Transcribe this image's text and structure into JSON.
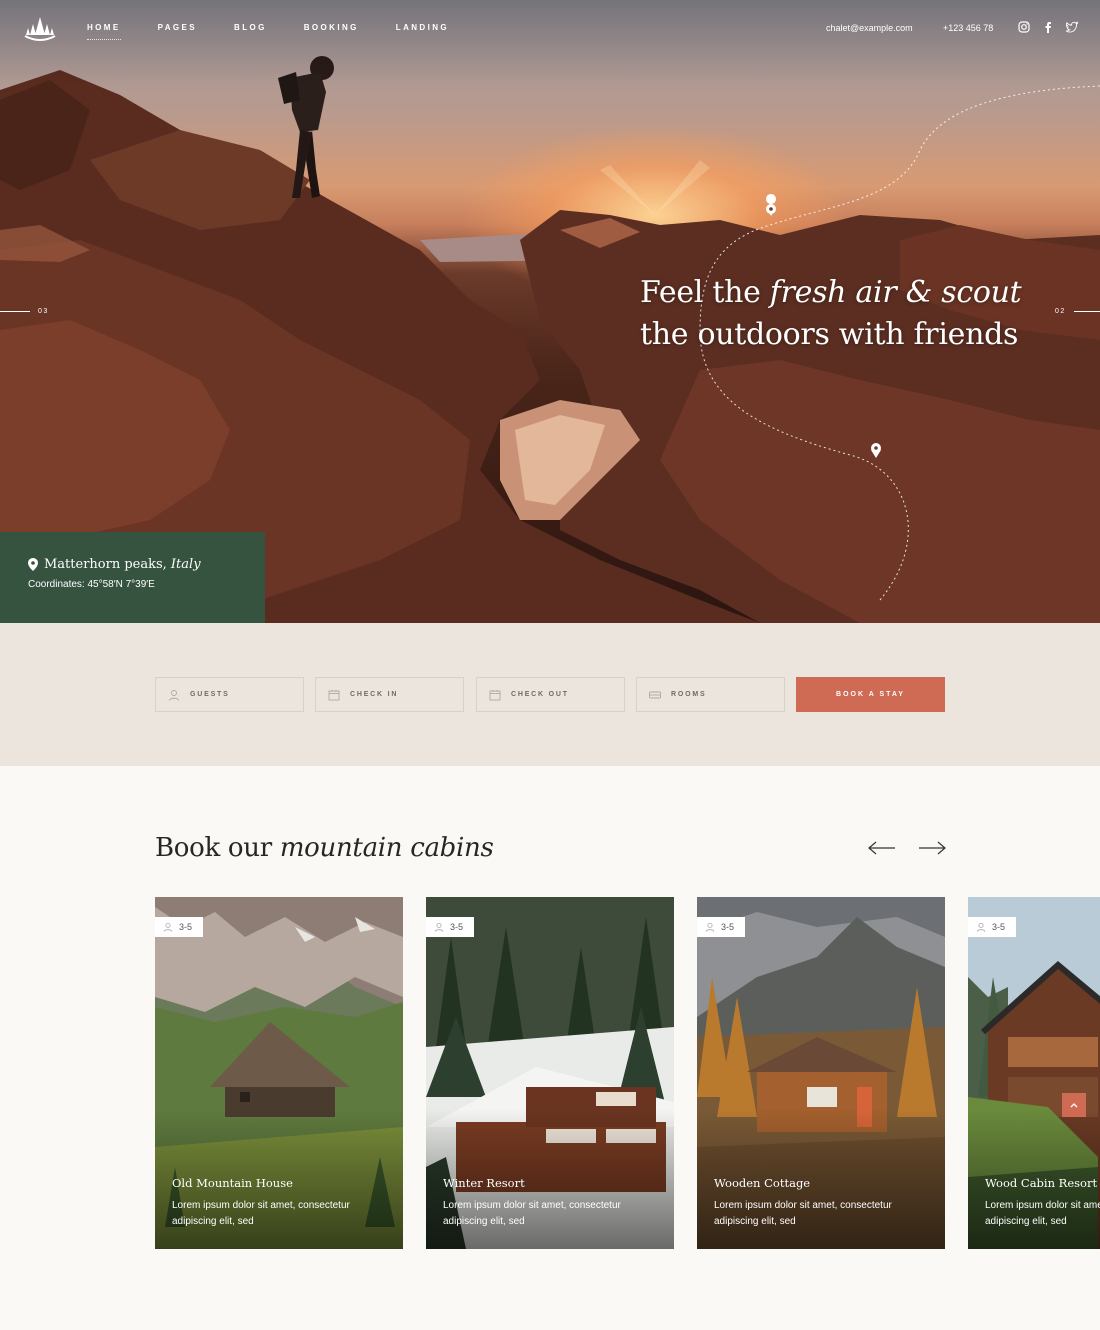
{
  "nav": {
    "links": [
      "HOME",
      "PAGES",
      "BLOG",
      "BOOKING",
      "LANDING"
    ],
    "email": "chalet@example.com",
    "phone": "+123 456 78"
  },
  "hero": {
    "headline_line1_a": "Feel the ",
    "headline_line1_em": "fresh air & scout",
    "headline_line2": "the outdoors with friends",
    "slide_prev": "03",
    "slide_next": "02",
    "location_name": "Matterhorn peaks, ",
    "location_country": "Italy",
    "coordinates": "Coordinates: 45°58′N 7°39′E"
  },
  "booking": {
    "guests": "GUESTS",
    "check_in": "CHECK IN",
    "check_out": "CHECK OUT",
    "rooms": "ROOMS",
    "button": "BOOK A STAY"
  },
  "cabins": {
    "title_a": "Book our ",
    "title_em": "mountain cabins",
    "items": [
      {
        "guests": "3-5",
        "title": "Old Mountain House",
        "desc": "Lorem ipsum dolor sit amet, consectetur adipiscing elit, sed"
      },
      {
        "guests": "3-5",
        "title": "Winter Resort",
        "desc": "Lorem ipsum dolor sit amet, consectetur adipiscing elit, sed"
      },
      {
        "guests": "3-5",
        "title": "Wooden Cottage",
        "desc": "Lorem ipsum dolor sit amet, consectetur adipiscing elit, sed"
      },
      {
        "guests": "3-5",
        "title": "Wood Cabin Resort",
        "desc": "Lorem ipsum dolor sit amet, consectetur adipiscing elit, sed"
      }
    ]
  },
  "colors": {
    "accent": "#cf6b55",
    "location_box": "#35533f",
    "booking_bg": "#ece5de"
  }
}
